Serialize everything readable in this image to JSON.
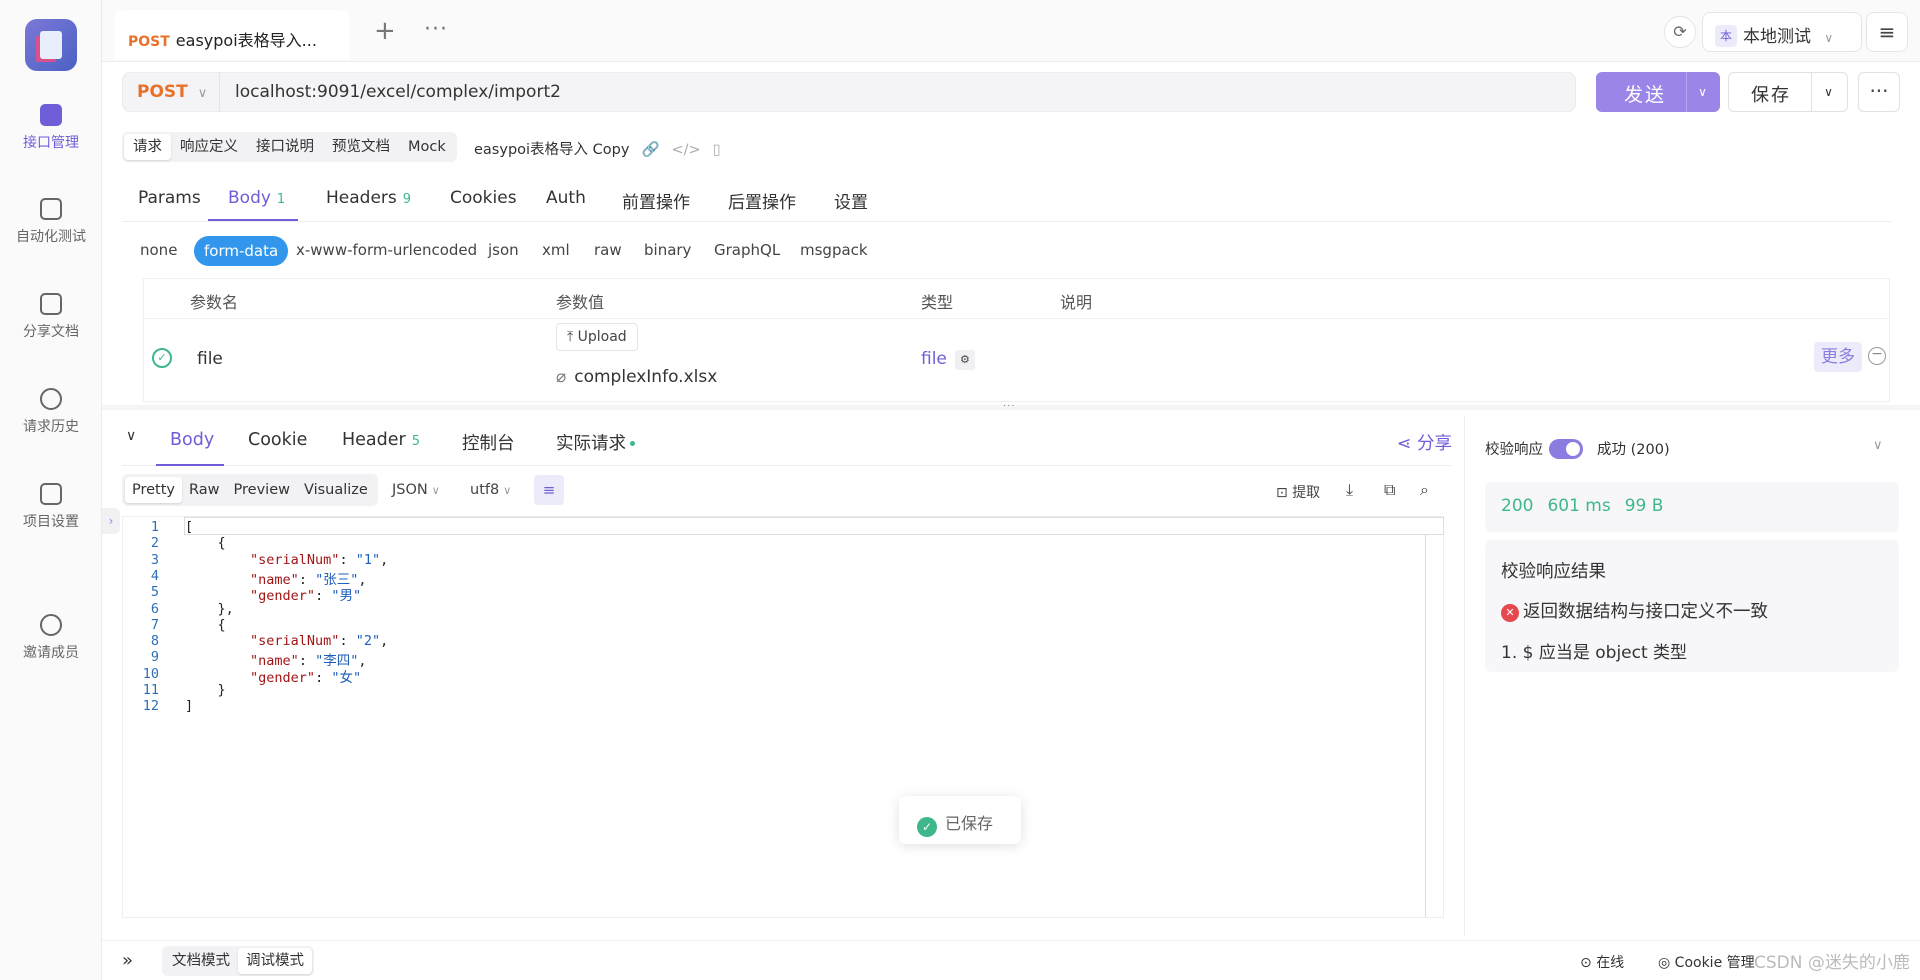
{
  "nav": {
    "items": [
      {
        "label": "接口管理"
      },
      {
        "label": "自动化测试"
      },
      {
        "label": "分享文档"
      },
      {
        "label": "请求历史"
      },
      {
        "label": "项目设置"
      },
      {
        "label": "邀请成员"
      }
    ]
  },
  "tabbar": {
    "tab": {
      "method": "POST",
      "title": "easypoi表格导入..."
    },
    "env": {
      "badge": "本",
      "label": "本地测试"
    }
  },
  "request": {
    "method": "POST",
    "url": "localhost:9091/excel/complex/import2",
    "send_label": "发送",
    "save_label": "保存"
  },
  "subtabs": [
    "请求",
    "响应定义",
    "接口说明",
    "预览文档",
    "Mock"
  ],
  "copy_name": "easypoi表格导入 Copy",
  "param_tabs": [
    {
      "label": "Params",
      "count": ""
    },
    {
      "label": "Body",
      "count": "1"
    },
    {
      "label": "Headers",
      "count": "9"
    },
    {
      "label": "Cookies",
      "count": ""
    },
    {
      "label": "Auth",
      "count": ""
    },
    {
      "label": "前置操作",
      "count": ""
    },
    {
      "label": "后置操作",
      "count": ""
    },
    {
      "label": "设置",
      "count": ""
    }
  ],
  "body_types": [
    "none",
    "form-data",
    "x-www-form-urlencoded",
    "json",
    "xml",
    "raw",
    "binary",
    "GraphQL",
    "msgpack"
  ],
  "params_table": {
    "headers": [
      "参数名",
      "参数值",
      "类型",
      "说明"
    ],
    "row": {
      "name": "file",
      "upload_label": "Upload",
      "file_name": "complexInfo.xlsx",
      "type": "file",
      "more_label": "更多"
    }
  },
  "response": {
    "tabs": [
      {
        "label": "Body",
        "count": ""
      },
      {
        "label": "Cookie",
        "count": ""
      },
      {
        "label": "Header",
        "count": "5"
      },
      {
        "label": "控制台",
        "count": ""
      },
      {
        "label": "实际请求",
        "count": ""
      }
    ],
    "share_label": "分享",
    "formats": [
      "Pretty",
      "Raw",
      "Preview",
      "Visualize"
    ],
    "lang": "JSON",
    "encoding": "utf8",
    "tools": {
      "extract": "提取"
    },
    "code": [
      "[",
      "    {",
      "        \"serialNum\": \"1\",",
      "        \"name\": \"张三\",",
      "        \"gender\": \"男\"",
      "    },",
      "    {",
      "        \"serialNum\": \"2\",",
      "        \"name\": \"李四\",",
      "        \"gender\": \"女\"",
      "    }",
      "]"
    ],
    "toast": "已保存"
  },
  "validation": {
    "label": "校验响应",
    "status": "成功 (200)",
    "code": "200",
    "time": "601 ms",
    "size": "99 B",
    "result_title": "校验响应结果",
    "error": "返回数据结构与接口定义不一致",
    "detail": "1. $ 应当是 object 类型"
  },
  "bottom": {
    "modes": [
      "文档模式",
      "调试模式"
    ],
    "online": "在线",
    "cookie": "Cookie 管理",
    "watermark": "CSDN @迷失的小鹿"
  }
}
